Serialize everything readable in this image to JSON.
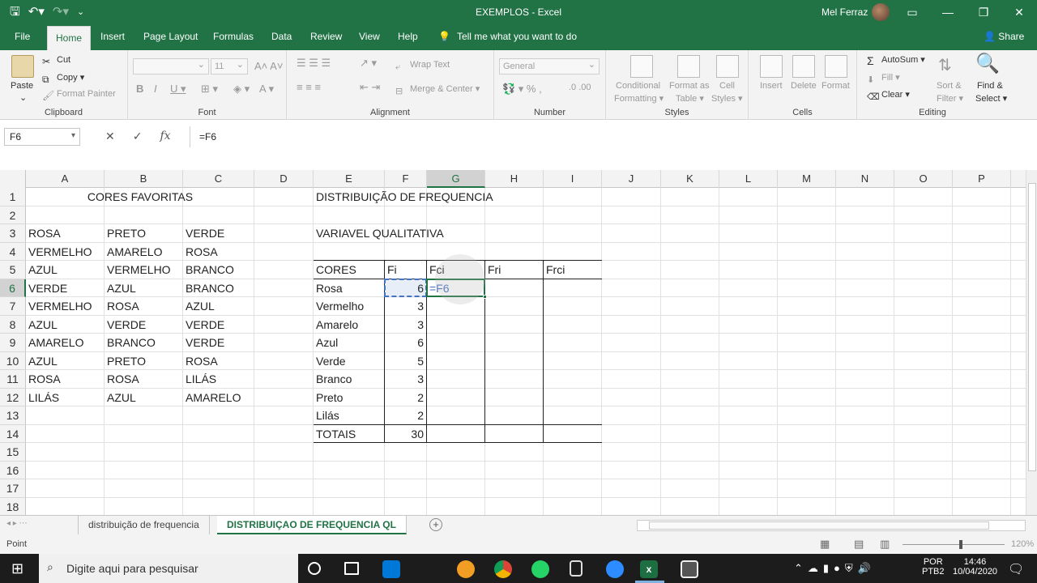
{
  "window": {
    "title": "EXEMPLOS  -  Excel",
    "user": "Mel Ferraz"
  },
  "menu": {
    "tabs": [
      "File",
      "Home",
      "Insert",
      "Page Layout",
      "Formulas",
      "Data",
      "Review",
      "View",
      "Help"
    ],
    "tell_me": "Tell me what you want to do",
    "share": "Share"
  },
  "ribbon": {
    "clipboard": {
      "paste": "Paste",
      "cut": "Cut",
      "copy": "Copy",
      "format_painter": "Format Painter",
      "label": "Clipboard"
    },
    "font": {
      "size": "11",
      "label": "Font"
    },
    "alignment": {
      "wrap_text": "Wrap Text",
      "merge_center": "Merge & Center",
      "label": "Alignment"
    },
    "number": {
      "format": "General",
      "label": "Number"
    },
    "styles": {
      "conditional": "Conditional",
      "formatting": "Formatting",
      "format_as": "Format as",
      "table": "Table",
      "cell": "Cell",
      "styles_btn": "Styles",
      "label": "Styles"
    },
    "cells": {
      "insert": "Insert",
      "delete": "Delete",
      "format": "Format",
      "label": "Cells"
    },
    "editing": {
      "autosum": "AutoSum",
      "fill": "Fill",
      "clear": "Clear",
      "sort": "Sort &",
      "filter": "Filter",
      "find": "Find &",
      "select": "Select",
      "label": "Editing"
    }
  },
  "formula_bar": {
    "name_box": "F6",
    "formula": "=F6"
  },
  "columns": [
    "A",
    "B",
    "C",
    "D",
    "E",
    "F",
    "G",
    "H",
    "I",
    "J",
    "K",
    "L",
    "M",
    "N",
    "O",
    "P"
  ],
  "rows": [
    "1",
    "2",
    "3",
    "4",
    "5",
    "6",
    "7",
    "8",
    "9",
    "10",
    "11",
    "12",
    "13",
    "14",
    "15",
    "16",
    "17",
    "18"
  ],
  "sheet": {
    "b1": "CORES FAVORITAS",
    "e1": "DISTRIBUIÇÃO DE FREQUENCIA",
    "e3": "VARIAVEL QUALITATIVA",
    "colors_list": [
      [
        "ROSA",
        "PRETO",
        "VERDE"
      ],
      [
        "VERMELHO",
        "AMARELO",
        "ROSA"
      ],
      [
        "AZUL",
        "VERMELHO",
        "BRANCO"
      ],
      [
        "VERDE",
        "AZUL",
        "BRANCO"
      ],
      [
        "VERMELHO",
        "ROSA",
        "AZUL"
      ],
      [
        "AZUL",
        "VERDE",
        "VERDE"
      ],
      [
        "AMARELO",
        "BRANCO",
        "VERDE"
      ],
      [
        "AZUL",
        "PRETO",
        "ROSA"
      ],
      [
        "ROSA",
        "ROSA",
        "LILÁS"
      ],
      [
        "LILÁS",
        "AZUL",
        "AMARELO"
      ]
    ],
    "table_headers": [
      "CORES",
      "Fi",
      "Fci",
      "Fri",
      "Frci"
    ],
    "table_rows": [
      [
        "Rosa",
        "6"
      ],
      [
        "Vermelho",
        "3"
      ],
      [
        "Amarelo",
        "3"
      ],
      [
        "Azul",
        "6"
      ],
      [
        "Verde",
        "5"
      ],
      [
        "Branco",
        "3"
      ],
      [
        "Preto",
        "2"
      ],
      [
        "Lilás",
        "2"
      ]
    ],
    "totals_label": "TOTAIS",
    "totals_value": "30",
    "editing_cell": "=F6"
  },
  "sheet_tabs": [
    "distribuição de frequencia",
    "DISTRIBUIÇAO DE FREQUENCIA QL"
  ],
  "status": {
    "mode": "Point",
    "zoom": "120%"
  },
  "taskbar": {
    "search": "Digite aqui para pesquisar",
    "lang1": "POR",
    "lang2": "PTB2",
    "time": "14:46",
    "date": "10/04/2020"
  },
  "colors": {
    "excel_green": "#217346",
    "ref_blue": "#4472c4"
  }
}
